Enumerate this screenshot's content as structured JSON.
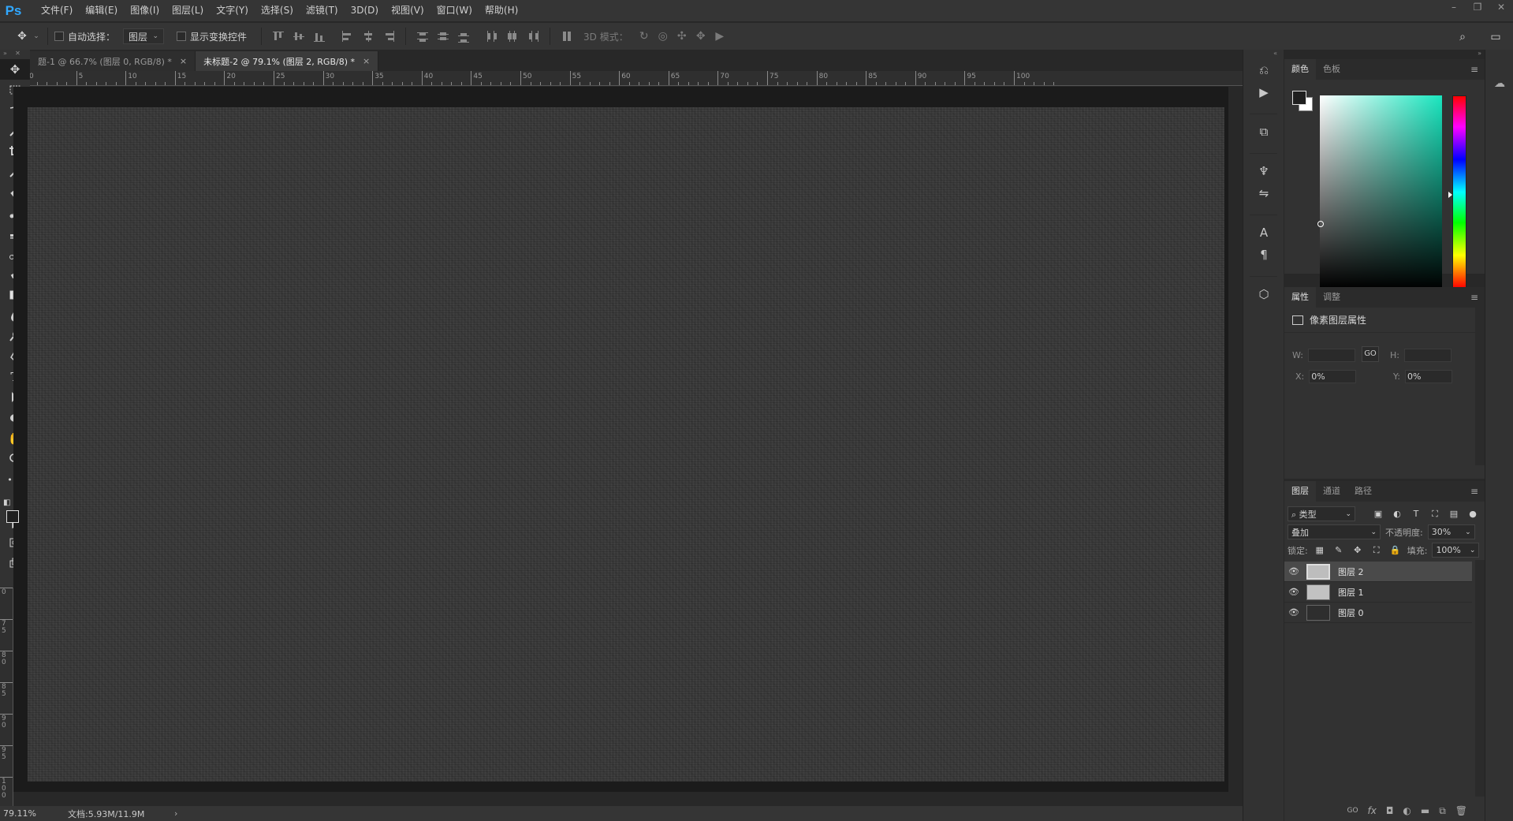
{
  "app": {
    "logo": "Ps"
  },
  "menu": [
    "文件(F)",
    "编辑(E)",
    "图像(I)",
    "图层(L)",
    "文字(Y)",
    "选择(S)",
    "滤镜(T)",
    "3D(D)",
    "视图(V)",
    "窗口(W)",
    "帮助(H)"
  ],
  "window_controls": {
    "minimize": "–",
    "restore": "❐",
    "close": "✕"
  },
  "options": {
    "auto_select_label": "自动选择：",
    "auto_select_value": "图层",
    "show_transform_label": "显示变换控件",
    "mode_3d_label": "3D 模式："
  },
  "tabs": [
    {
      "label": "题-1 @ 66.7% (图层 0, RGB/8) *",
      "close": "×"
    },
    {
      "label": "未标题-2 @ 79.1% (图层 2, RGB/8) *",
      "close": "×"
    }
  ],
  "ruler_h_labels": [
    "0",
    "5",
    "10",
    "15",
    "20",
    "25",
    "30",
    "35",
    "40",
    "45",
    "50",
    "55",
    "60",
    "65",
    "70",
    "75",
    "80",
    "85",
    "90",
    "95",
    "100"
  ],
  "ruler_v_labels": [
    "0",
    "75",
    "80",
    "85",
    "90",
    "95",
    "100"
  ],
  "status": {
    "zoom": "79.11%",
    "doc": "文档:5.93M/11.9M",
    "arrow": "›"
  },
  "color_panel": {
    "tabs": [
      "颜色",
      "色板"
    ],
    "hue_color": "#19e6bf",
    "fg_color": "#1f1f1f",
    "bg_color": "#ffffff"
  },
  "props_panel": {
    "tabs": [
      "属性",
      "调整"
    ],
    "title": "像素图层属性",
    "w_label": "W:",
    "w_value": "",
    "h_label": "H:",
    "h_value": "",
    "x_label": "X:",
    "x_value": "0%",
    "y_label": "Y:",
    "y_value": "0%",
    "link_icon": "GO"
  },
  "layers_panel": {
    "tabs": [
      "图层",
      "通道",
      "路径"
    ],
    "filter_label": "类型",
    "blend_mode": "叠加",
    "opacity_label": "不透明度:",
    "opacity_value": "30%",
    "lock_label": "锁定:",
    "fill_label": "填充:",
    "fill_value": "100%",
    "layers": [
      {
        "name": "图层 2",
        "selected": true,
        "thumb": "#bdbdbd"
      },
      {
        "name": "图层 1",
        "selected": false,
        "thumb": "#c2c2c2"
      },
      {
        "name": "图层 0",
        "selected": false,
        "thumb": "#2e2e2e"
      }
    ],
    "footer": [
      "GO",
      "fx",
      "◘",
      "◐",
      "▬",
      "⧉",
      "🗑"
    ]
  },
  "dock_icons": [
    "history-icon",
    "actions-icon",
    "clone-source-icon",
    "brushes-icon",
    "brush-settings-icon",
    "character-icon",
    "paragraph-icon",
    "3d-icon"
  ],
  "dock_glyphs": {
    "character": "A",
    "paragraph": "¶"
  },
  "tools_glyphs": {
    "type": "T",
    "more": "•••"
  }
}
